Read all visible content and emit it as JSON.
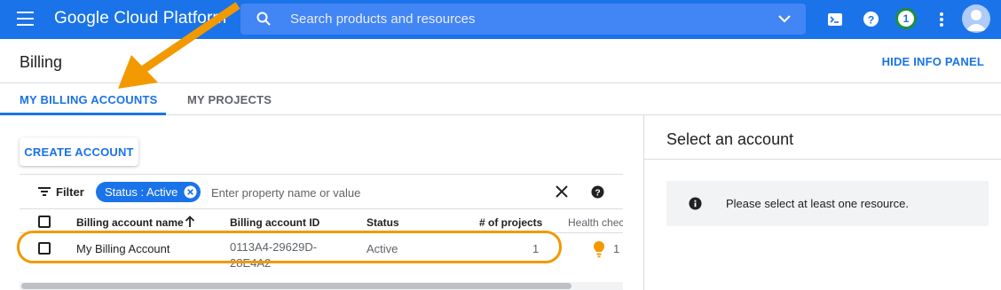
{
  "topbar": {
    "brand": "Google Cloud Platform",
    "search_placeholder": "Search products and resources",
    "notification_count": "1",
    "icons": [
      "menu-icon",
      "search-icon",
      "chevron-down-icon",
      "cloud-shell-icon",
      "help-icon",
      "more-vert-icon",
      "avatar-icon"
    ]
  },
  "header": {
    "title": "Billing",
    "hide_info": "HIDE INFO PANEL"
  },
  "tabs": [
    {
      "label": "MY BILLING ACCOUNTS",
      "active": true
    },
    {
      "label": "MY PROJECTS",
      "active": false
    }
  ],
  "actions": {
    "create_account": "CREATE ACCOUNT"
  },
  "filter": {
    "label": "Filter",
    "chip": "Status : Active",
    "placeholder": "Enter property name or value"
  },
  "table": {
    "columns": [
      "Billing account name",
      "Billing account ID",
      "Status",
      "# of projects",
      "Health chec"
    ],
    "rows": [
      {
        "name": "My Billing Account",
        "id": "0113A4-29629D-28E4A2",
        "status": "Active",
        "projects": "1",
        "health": "1"
      }
    ]
  },
  "info_panel": {
    "title": "Select an account",
    "message": "Please select at least one resource."
  },
  "colors": {
    "topbar": "#1a73e8",
    "accent": "#1a73e8",
    "annotation": "#f29900"
  }
}
